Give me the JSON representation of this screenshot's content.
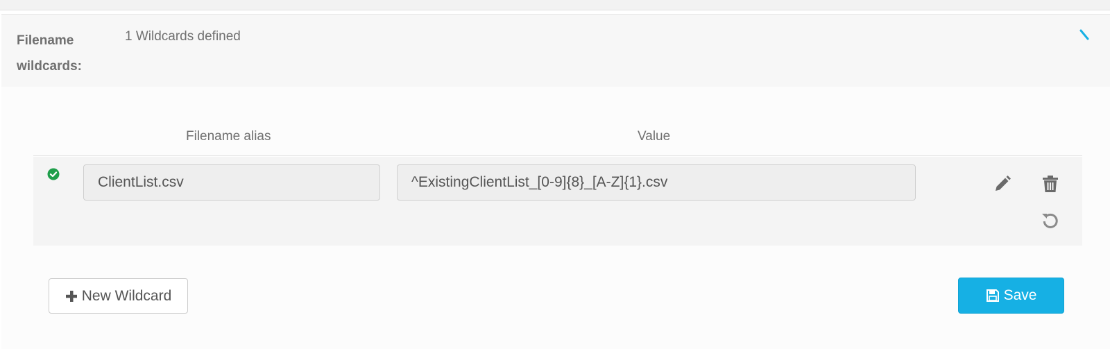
{
  "section": {
    "label_line1": "Filename",
    "label_line2": "wildcards:",
    "summary": "1 Wildcards defined"
  },
  "table": {
    "columns": [
      "Filename alias",
      "Value"
    ],
    "rows": [
      {
        "status": "valid",
        "alias": "ClientList.csv",
        "value": "^ExistingClientList_[0-9]{8}_[A-Z]{1}.csv"
      }
    ]
  },
  "actions": {
    "new_label": "New Wildcard",
    "save_label": "Save"
  },
  "colors": {
    "accent": "#16b0e4",
    "success": "#1e9e4a"
  },
  "icons": [
    "collapse-icon",
    "check-circle-icon",
    "pencil-icon",
    "trash-icon",
    "undo-icon",
    "plus-icon",
    "save-icon"
  ]
}
